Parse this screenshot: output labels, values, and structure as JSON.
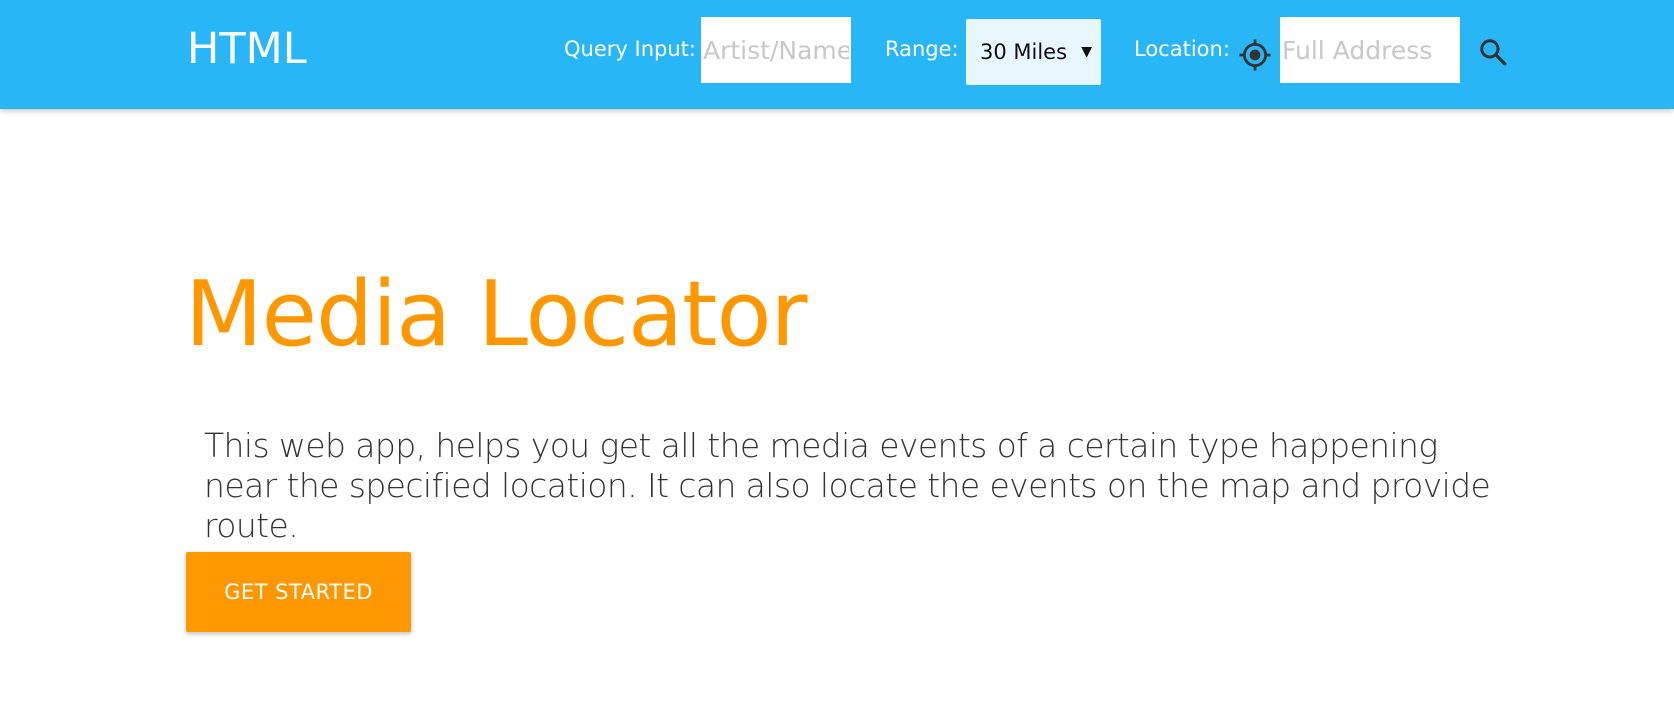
{
  "navbar": {
    "brand": "HTML",
    "query_label": "Query Input:",
    "query_placeholder": "Artist/Name",
    "range_label": "Range:",
    "range_value": "30 Miles",
    "location_label": "Location:",
    "location_placeholder": "Full Address",
    "icons": [
      "gps-fixed-icon",
      "search-icon"
    ],
    "background_color": "#29b6f6"
  },
  "hero": {
    "title": "Media Locator",
    "description": "This web app, helps you get all the media events of a certain type happening near the specified location. It can also locate the events on the map and provide route.",
    "cta_label": "GET STARTED",
    "accent_color": "#ff9800"
  }
}
